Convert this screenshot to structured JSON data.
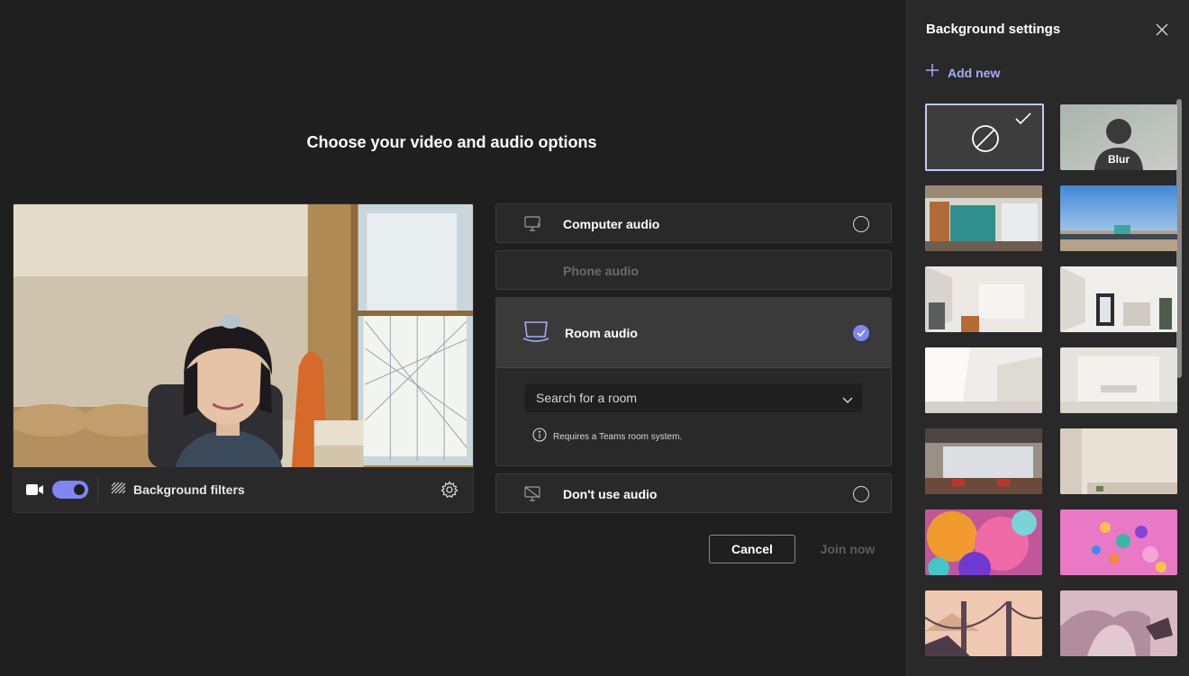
{
  "page": {
    "title": "Choose your video and audio options"
  },
  "preview": {
    "background_filters_label": "Background filters",
    "camera_toggle_on": true
  },
  "audio": {
    "computer": "Computer audio",
    "phone": "Phone audio",
    "room": "Room audio",
    "room_search_placeholder": "Search for a room",
    "room_note": "Requires a Teams room system.",
    "none": "Don't use audio"
  },
  "actions": {
    "cancel": "Cancel",
    "join": "Join now"
  },
  "panel": {
    "title": "Background settings",
    "add_new": "Add new",
    "blur_label": "Blur"
  },
  "colors": {
    "accent": "#7f85f5",
    "accent_text": "#a7abf5",
    "panel_bg": "#292929",
    "page_bg": "#1f1f1f"
  }
}
